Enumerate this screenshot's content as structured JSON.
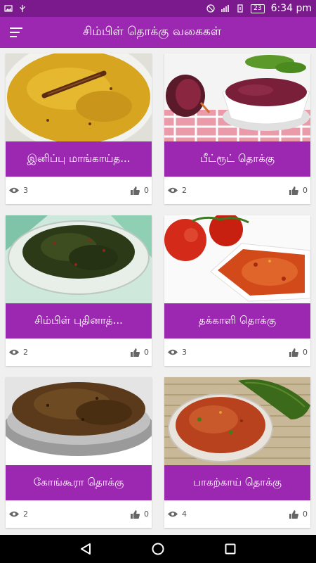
{
  "status_bar": {
    "time": "6:34 pm",
    "battery": "23"
  },
  "app_bar": {
    "title": "சிம்பிள் தொக்கு வகைகள்"
  },
  "recipes": [
    {
      "title": "இனிப்பு மாங்காய்த...",
      "views": "3",
      "likes": "0"
    },
    {
      "title": "பீட்ரூட் தொக்கு",
      "views": "2",
      "likes": "0"
    },
    {
      "title": "சிம்பிள் புதினாத்...",
      "views": "2",
      "likes": "0"
    },
    {
      "title": "தக்காளி தொக்கு",
      "views": "3",
      "likes": "0"
    },
    {
      "title": "கோங்கூரா தொக்கு",
      "views": "2",
      "likes": "0"
    },
    {
      "title": "பாகற்காய் தொக்கு",
      "views": "4",
      "likes": "0"
    }
  ],
  "colors": {
    "primary": "#9c27b0",
    "status_bar": "#7b1a8c",
    "nav_bar": "#000000"
  },
  "icons": {
    "menu": "menu-icon",
    "views": "eye-icon",
    "likes": "thumbs-up-icon"
  }
}
